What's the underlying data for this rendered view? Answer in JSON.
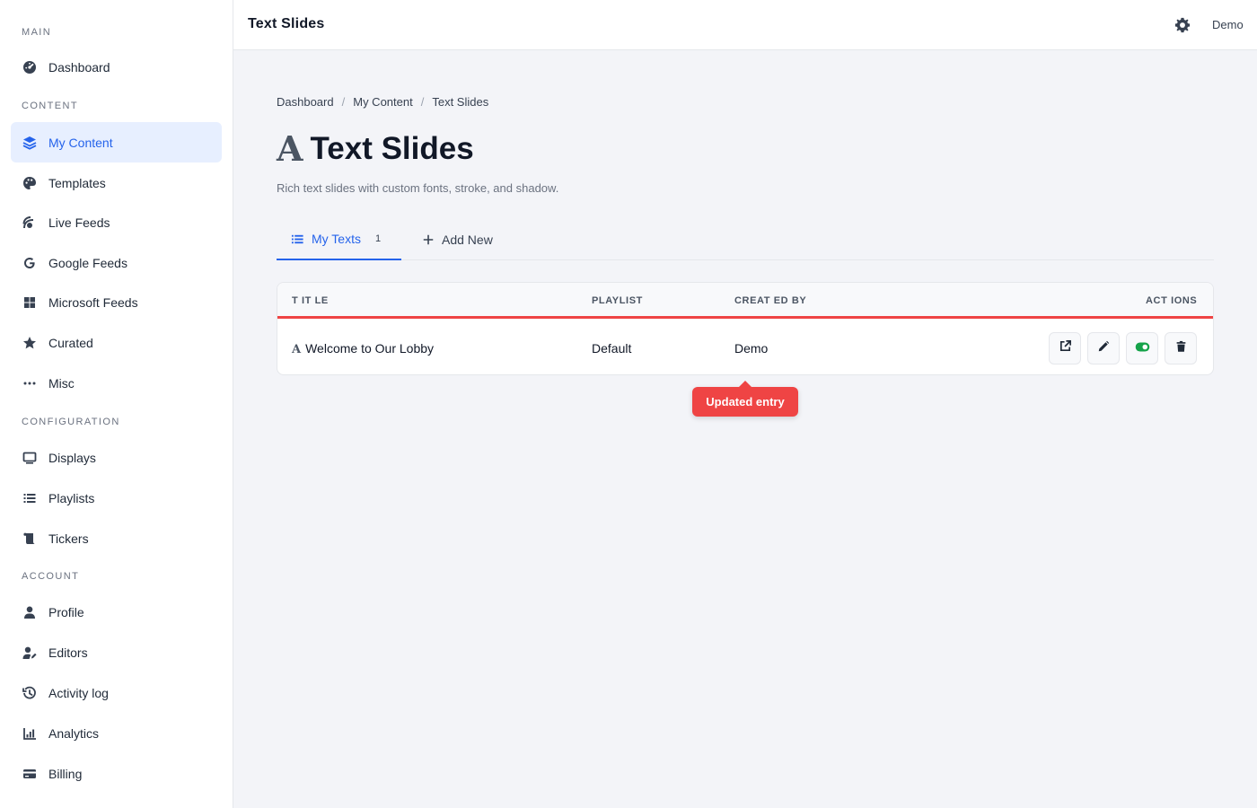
{
  "sidebar": {
    "sections": [
      "MAIN",
      "CONTENT",
      "CONFIGURATION",
      "ACCOUNT"
    ],
    "items": [
      {
        "label": "Dashboard",
        "icon": "dashboard-icon"
      },
      {
        "label": "My Content",
        "icon": "layers-icon",
        "active": true
      },
      {
        "label": "Templates",
        "icon": "palette-icon"
      },
      {
        "label": "Live Feeds",
        "icon": "broadcast-icon"
      },
      {
        "label": "Google Feeds",
        "icon": "google-icon"
      },
      {
        "label": "Microsoft Feeds",
        "icon": "windows-icon"
      },
      {
        "label": "Curated",
        "icon": "star-icon"
      },
      {
        "label": "Misc",
        "icon": "ellipsis-icon"
      },
      {
        "label": "Displays",
        "icon": "monitor-icon"
      },
      {
        "label": "Playlists",
        "icon": "list-icon"
      },
      {
        "label": "Tickers",
        "icon": "scroll-icon"
      },
      {
        "label": "Profile",
        "icon": "user-icon"
      },
      {
        "label": "Editors",
        "icon": "user-edit-icon"
      },
      {
        "label": "Activity log",
        "icon": "history-icon"
      },
      {
        "label": "Analytics",
        "icon": "chart-icon"
      },
      {
        "label": "Billing",
        "icon": "credit-card-icon"
      }
    ]
  },
  "topbar": {
    "title": "Text Slides",
    "user": "Demo"
  },
  "breadcrumb": [
    "Dashboard",
    "My Content",
    "Text Slides"
  ],
  "page": {
    "icon_glyph": "A",
    "title": "Text Slides",
    "subtitle": "Rich text slides with custom fonts, stroke, and shadow."
  },
  "tabs": {
    "my_texts": "My Texts",
    "my_texts_count": "1",
    "add_new": "Add New"
  },
  "table": {
    "headers": [
      "T IT LE",
      "PLAYLIST",
      "CREAT ED BY",
      "ACT IONS"
    ],
    "rows": [
      {
        "icon_glyph": "A",
        "title": "Welcome to Our Lobby",
        "playlist": "Default",
        "created_by": "Demo"
      }
    ]
  },
  "toast": {
    "text": "Updated entry"
  },
  "colors": {
    "accent": "#2563eb",
    "danger": "#ef4444",
    "toggle_on": "#16a34a"
  }
}
